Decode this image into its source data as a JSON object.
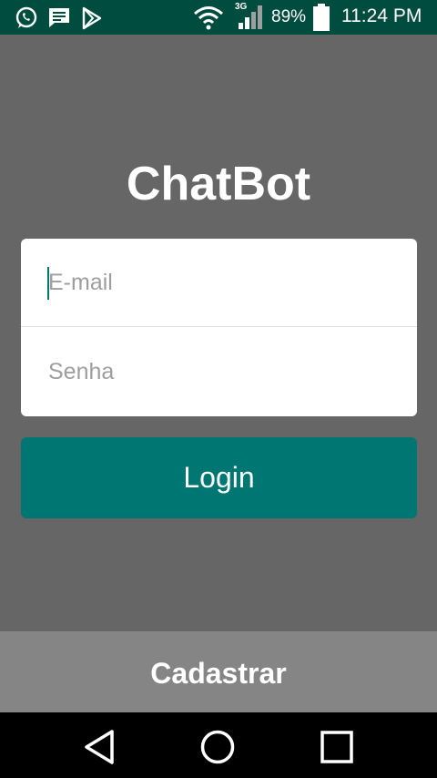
{
  "status_bar": {
    "battery_percent": "89%",
    "time": "11:24 PM",
    "network_type": "3G",
    "icons": [
      "whatsapp-icon",
      "message-icon",
      "play-store-icon",
      "wifi-icon",
      "signal-icon",
      "battery-icon"
    ]
  },
  "app": {
    "title": "ChatBot"
  },
  "form": {
    "email_placeholder": "E-mail",
    "email_value": "",
    "password_placeholder": "Senha",
    "password_value": ""
  },
  "login_button": {
    "label": "Login"
  },
  "register": {
    "label": "Cadastrar"
  },
  "nav_bar": {
    "icons": [
      "back-icon",
      "home-icon",
      "recents-icon"
    ]
  },
  "colors": {
    "status_bar": "#004d40",
    "background": "#666666",
    "accent": "#007672",
    "register_bar": "#858585"
  }
}
